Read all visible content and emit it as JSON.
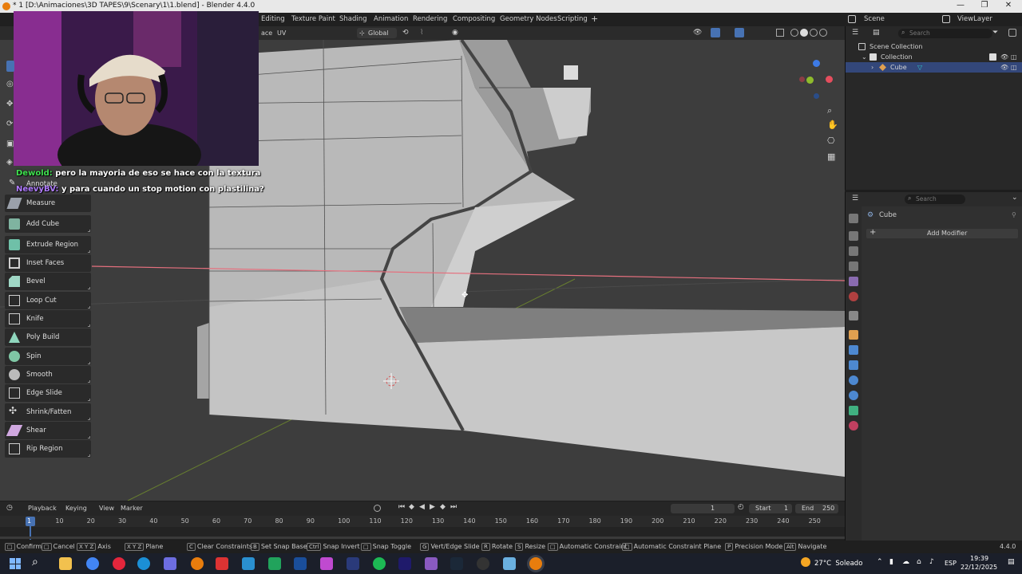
{
  "window": {
    "title": "* 1 [D:\\Animaciones\\3D TAPES\\9\\Scenary\\1\\1.blend] - Blender 4.4.0",
    "minimize": "—",
    "maximize": "❐",
    "close": "✕"
  },
  "workspaces": [
    "Editing",
    "Texture Paint",
    "Shading",
    "Animation",
    "Rendering",
    "Compositing",
    "Geometry Nodes",
    "Scripting"
  ],
  "add_workspace": "+",
  "scene": {
    "label": "Scene",
    "viewlayer": "ViewLayer"
  },
  "viewport_header": {
    "face_menu": "ace",
    "uv_menu": "UV",
    "transform_orientation": "Global"
  },
  "chat": [
    {
      "user": "Dewold:",
      "text": " pero la mayoria de eso se hace con la textura"
    },
    {
      "user": "NeevyBV:",
      "text": " y para cuando un stop motion con plastilina?"
    }
  ],
  "tools": [
    {
      "label": "Annotate"
    },
    {
      "label": "Measure"
    },
    {
      "label": "Add Cube"
    },
    {
      "label": "Extrude Region"
    },
    {
      "label": "Inset Faces"
    },
    {
      "label": "Bevel"
    },
    {
      "label": "Loop Cut"
    },
    {
      "label": "Knife"
    },
    {
      "label": "Poly Build"
    },
    {
      "label": "Spin"
    },
    {
      "label": "Smooth"
    },
    {
      "label": "Edge Slide"
    },
    {
      "label": "Shrink/Fatten"
    },
    {
      "label": "Shear"
    },
    {
      "label": "Rip Region"
    }
  ],
  "outliner": {
    "search_placeholder": "Search",
    "scene_collection": "Scene Collection",
    "collection": "Collection",
    "object": "Cube"
  },
  "properties": {
    "search_placeholder": "Search",
    "object": "Cube",
    "add_modifier": "Add Modifier"
  },
  "timeline": {
    "menus": [
      "Playback",
      "Keying",
      "View",
      "Marker"
    ],
    "current_frame": "1",
    "start_label": "Start",
    "start": "1",
    "end_label": "End",
    "end": "250",
    "ruler": [
      "1",
      "10",
      "20",
      "30",
      "40",
      "50",
      "60",
      "70",
      "80",
      "90",
      "100",
      "110",
      "120",
      "130",
      "140",
      "150",
      "160",
      "170",
      "180",
      "190",
      "200",
      "210",
      "220",
      "230",
      "240",
      "250"
    ]
  },
  "statusbar": {
    "items": [
      {
        "key": "",
        "label": "Confirm"
      },
      {
        "key": "",
        "label": "Cancel"
      },
      {
        "key": "X Y Z",
        "label": "Axis"
      },
      {
        "key": "X Y Z",
        "label": "Plane"
      },
      {
        "key": "C",
        "label": "Clear Constraints"
      },
      {
        "key": "B",
        "label": "Set Snap Base"
      },
      {
        "key": "Ctrl",
        "label": "Snap Invert"
      },
      {
        "key": "",
        "label": "Snap Toggle"
      },
      {
        "key": "G",
        "label": "Vert/Edge Slide"
      },
      {
        "key": "R",
        "label": "Rotate"
      },
      {
        "key": "S",
        "label": "Resize"
      },
      {
        "key": "",
        "label": "Automatic Constraint"
      },
      {
        "key": "",
        "label": "Automatic Constraint Plane"
      },
      {
        "key": "P",
        "label": "Precision Mode"
      },
      {
        "key": "Alt",
        "label": "Navigate"
      }
    ],
    "version": "4.4.0"
  },
  "taskbar": {
    "weather": "27°C  Soleado",
    "lang": "ESP",
    "time": "19:39",
    "date": "22/12/2025"
  },
  "colors": {
    "accent": "#4772b3",
    "x_axis": "#e54e5e",
    "y_axis": "#8fbb2c",
    "z_axis": "#3d7ae5",
    "blender_orange": "#e87d0d"
  }
}
